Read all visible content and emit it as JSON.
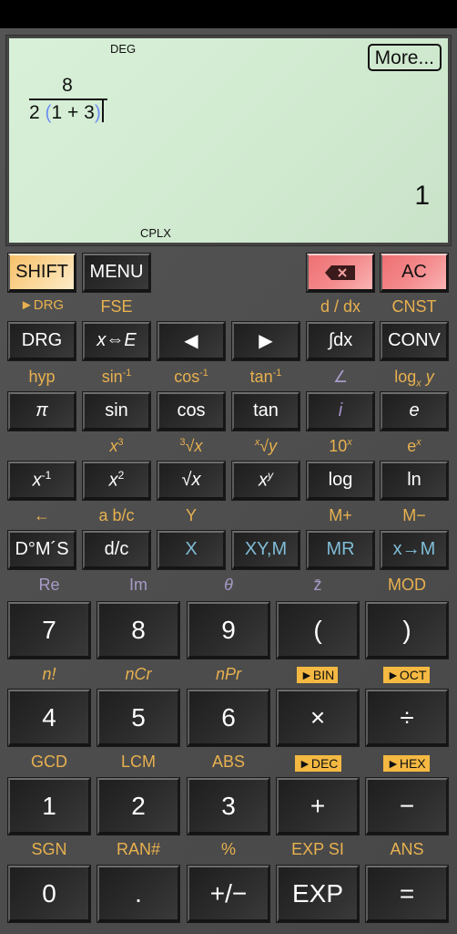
{
  "display": {
    "angle_mode": "DEG",
    "complex_mode": "CPLX",
    "more_label": "More...",
    "expression": {
      "numerator": "8",
      "denominator_prefix": "2",
      "open_paren": "(",
      "inner": "1 + 3",
      "close_paren": ")"
    },
    "result": "1"
  },
  "colors": {
    "display_bg": "#d4ecd4",
    "shift_accent": "#e8b14f",
    "alpha_accent": "#a89bc7",
    "memory_blue": "#7fbdd6",
    "delete_red": "#f08688",
    "shift_key": "#f9cf85"
  },
  "top_row": {
    "shift": "SHIFT",
    "menu": "MENU",
    "backspace_icon": "backspace-icon",
    "ac": "AC"
  },
  "row1": {
    "labels": [
      "►DRG",
      "FSE",
      "",
      "",
      "d / dx",
      "CNST"
    ],
    "keys": [
      "DRG",
      "x⇔E",
      "◀",
      "▶",
      "∫dx",
      "CONV"
    ]
  },
  "row2": {
    "labels": [
      "hyp",
      "sin-1",
      "cos-1",
      "tan-1",
      "∠",
      "logx y"
    ],
    "keys": [
      "π",
      "sin",
      "cos",
      "tan",
      "i",
      "e"
    ]
  },
  "row3": {
    "labels": [
      "",
      "x3",
      "3√x",
      "x√y",
      "10x",
      "ex"
    ],
    "keys": [
      "x-1",
      "x2",
      "√x",
      "xy",
      "log",
      "ln"
    ]
  },
  "row4": {
    "labels": [
      "←",
      "a b/c",
      "Y",
      "",
      "M+",
      "M−"
    ],
    "keys": [
      "D°M´S",
      "d/c",
      "X",
      "XY,M",
      "MR",
      "x→M"
    ]
  },
  "row5": {
    "labels": [
      "Re",
      "Im",
      "θ",
      "z̄",
      "MOD"
    ],
    "keys": [
      "7",
      "8",
      "9",
      "(",
      ")"
    ]
  },
  "row6": {
    "labels": [
      "n!",
      "nCr",
      "nPr",
      "►BIN",
      "►OCT"
    ],
    "keys": [
      "4",
      "5",
      "6",
      "×",
      "÷"
    ]
  },
  "row7": {
    "labels": [
      "GCD",
      "LCM",
      "ABS",
      "►DEC",
      "►HEX"
    ],
    "keys": [
      "1",
      "2",
      "3",
      "+",
      "−"
    ]
  },
  "row8": {
    "labels": [
      "SGN",
      "RAN#",
      "%",
      "EXP SI",
      "ANS"
    ],
    "keys": [
      "0",
      ".",
      "+/−",
      "EXP",
      "="
    ]
  }
}
